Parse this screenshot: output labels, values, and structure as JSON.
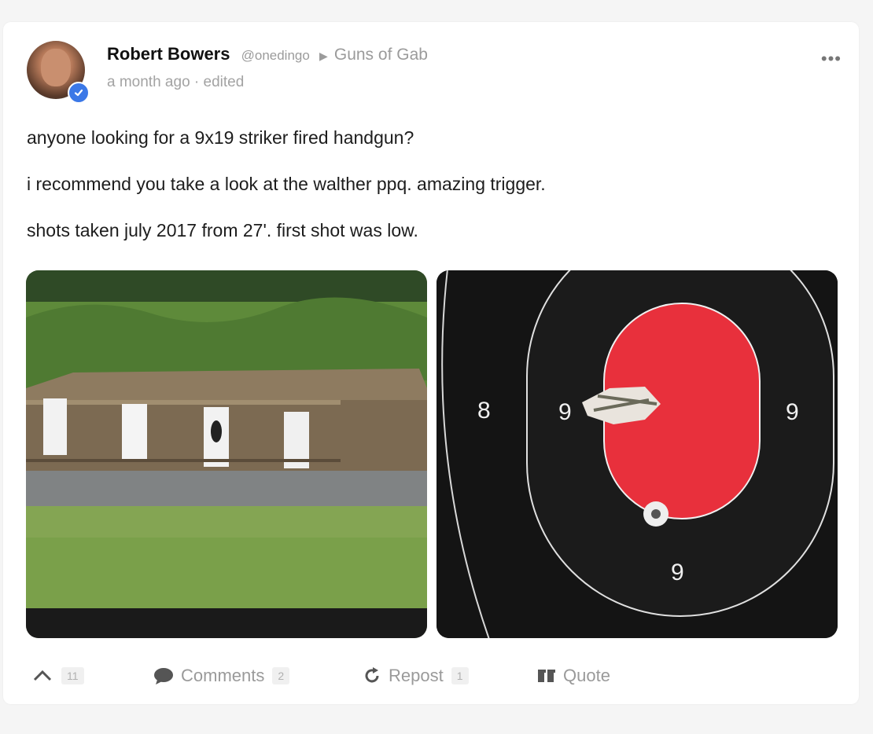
{
  "post": {
    "author_name": "Robert Bowers",
    "handle": "@onedingo",
    "group": "Guns of Gab",
    "timestamp": "a month ago",
    "edited": "· edited",
    "more_icon": "•••",
    "body": [
      "anyone looking for a 9x19 striker fired handgun?",
      "i recommend you take a look at the walther ppq. amazing trigger.",
      "shots taken july 2017 from 27'. first shot was low."
    ]
  },
  "images": {
    "right_target_labels": [
      "8",
      "9",
      "9",
      "9"
    ]
  },
  "actions": {
    "upvote_count": "11",
    "comments_label": "Comments",
    "comments_count": "2",
    "repost_label": "Repost",
    "repost_count": "1",
    "quote_label": "Quote"
  },
  "icons": {
    "upvote": "chevron-up-icon",
    "comments": "speech-bubble-icon",
    "repost": "repost-icon",
    "quote": "quote-icon",
    "verified": "verified-badge-icon"
  },
  "colors": {
    "verified_blue": "#3b78e7",
    "target_red": "#e8303c",
    "muted_gray": "#9b9b9b"
  }
}
